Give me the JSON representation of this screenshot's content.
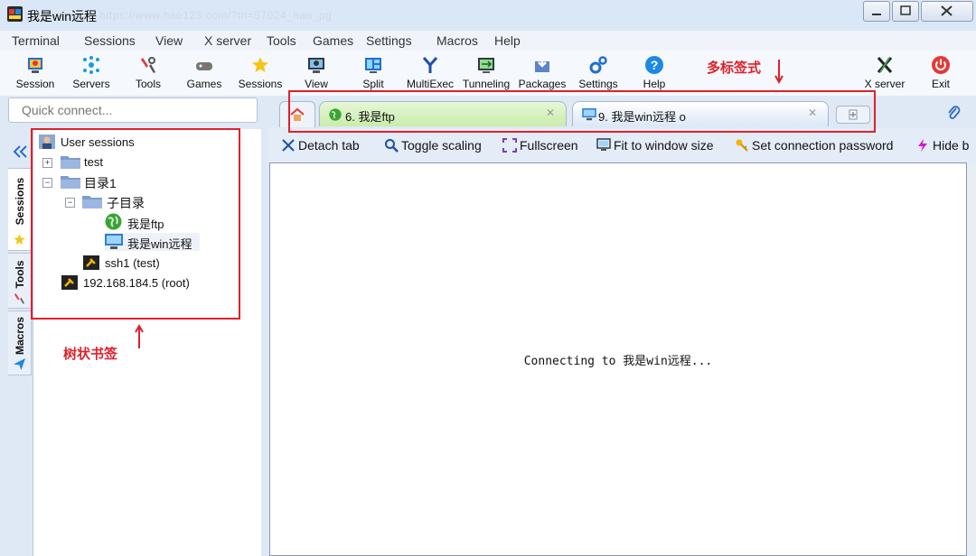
{
  "window": {
    "title": "我是win远程",
    "url_watermark": "https://www.hao123.com/?tn=57024_hao_pg",
    "controls": [
      "minimize-icon",
      "maximize-icon",
      "close-icon"
    ]
  },
  "menu": [
    "Terminal",
    "Sessions",
    "View",
    "X server",
    "Tools",
    "Games",
    "Settings",
    "Macros",
    "Help"
  ],
  "toolbar": {
    "session": "Session",
    "servers": "Servers",
    "tools": "Tools",
    "games": "Games",
    "sessions": "Sessions",
    "view": "View",
    "split": "Split",
    "multiexec": "MultiExec",
    "tunneling": "Tunneling",
    "packages": "Packages",
    "settings": "Settings",
    "help": "Help",
    "xserver": "X server",
    "exit": "Exit"
  },
  "quick_connect": {
    "placeholder": "Quick connect..."
  },
  "side_tabs": [
    "Sessions",
    "Tools",
    "Macros"
  ],
  "tree": {
    "root": "User sessions",
    "items": [
      {
        "label": "test",
        "type": "folder"
      },
      {
        "label": "目录1",
        "type": "folder"
      },
      {
        "label": "子目录",
        "type": "folder"
      },
      {
        "label": "我是ftp",
        "type": "ftp"
      },
      {
        "label": "我是win远程",
        "type": "rdp"
      },
      {
        "label": "ssh1 (test)",
        "type": "ssh"
      },
      {
        "label": "192.168.184.5 (root)",
        "type": "ssh"
      }
    ]
  },
  "tabs": [
    {
      "label": "6. 我是ftp",
      "active": false
    },
    {
      "label": "9. 我是win远程  o",
      "active": true
    }
  ],
  "actions": {
    "detach": "Detach tab",
    "toggle_scaling": "Toggle scaling",
    "fullscreen": "Fullscreen",
    "fit": "Fit to window size",
    "set_password": "Set connection password",
    "hide": "Hide b"
  },
  "terminal": {
    "message": "Connecting to 我是win远程..."
  },
  "annotations": {
    "tabs_label": "多标签式",
    "tree_label": "树状书签"
  },
  "colors": {
    "accent_red": "#e0202a",
    "ftp_tab": "#c9ecab",
    "active_tab": "#dbe8f7"
  }
}
